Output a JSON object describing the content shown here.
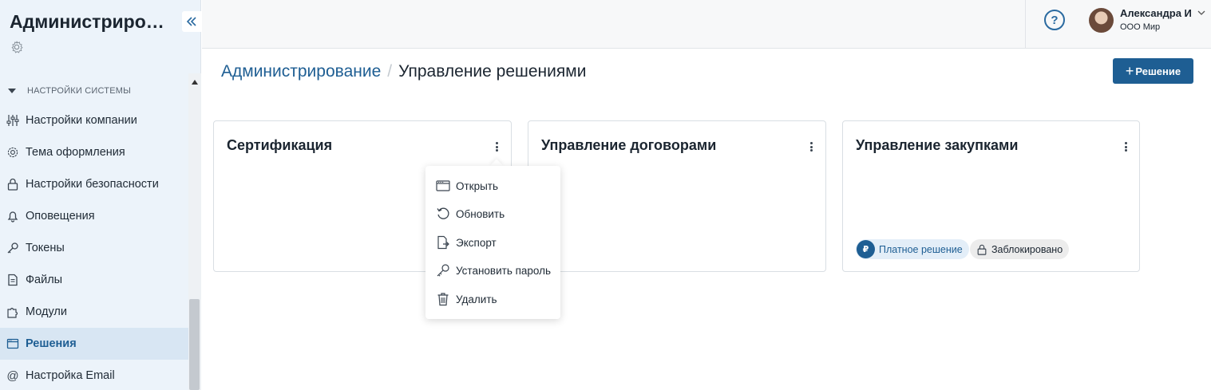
{
  "app": {
    "title": "Администрирование"
  },
  "sidebar": {
    "section_label": "НАСТРОЙКИ СИСТЕМЫ",
    "items": [
      {
        "label": "Настройки компании",
        "icon": "sliders-icon"
      },
      {
        "label": "Тема оформления",
        "icon": "gear-icon"
      },
      {
        "label": "Настройки безопасности",
        "icon": "lock-icon"
      },
      {
        "label": "Оповещения",
        "icon": "bell-icon"
      },
      {
        "label": "Токены",
        "icon": "key-icon"
      },
      {
        "label": "Файлы",
        "icon": "file-icon"
      },
      {
        "label": "Модули",
        "icon": "puzzle-icon"
      },
      {
        "label": "Решения",
        "icon": "window-icon",
        "active": true
      },
      {
        "label": "Настройка Email",
        "icon": "at-icon"
      }
    ]
  },
  "topbar": {
    "help": "?",
    "user": {
      "name": "Александра И",
      "org": "ООО Мир"
    }
  },
  "header": {
    "breadcrumb_root": "Администрирование",
    "breadcrumb_sep": "/",
    "breadcrumb_current": "Управление решениями",
    "add_button": "Решение",
    "add_button_plus": "+"
  },
  "cards": [
    {
      "title": "Сертификация"
    },
    {
      "title": "Управление договорами"
    },
    {
      "title": "Управление закупками",
      "badges": {
        "paid": "Платное решение",
        "paid_symbol": "₽",
        "locked": "Заблокировано"
      }
    }
  ],
  "menu": {
    "items": [
      {
        "label": "Открыть",
        "icon": "window-icon"
      },
      {
        "label": "Обновить",
        "icon": "refresh-icon"
      },
      {
        "label": "Экспорт",
        "icon": "export-icon"
      },
      {
        "label": "Установить пароль",
        "icon": "key-icon"
      },
      {
        "label": "Удалить",
        "icon": "trash-icon"
      }
    ]
  },
  "colors": {
    "accent": "#1e5e93",
    "sidebar_bg": "#ecf3fa",
    "active_item_bg": "#d8e6f3"
  }
}
